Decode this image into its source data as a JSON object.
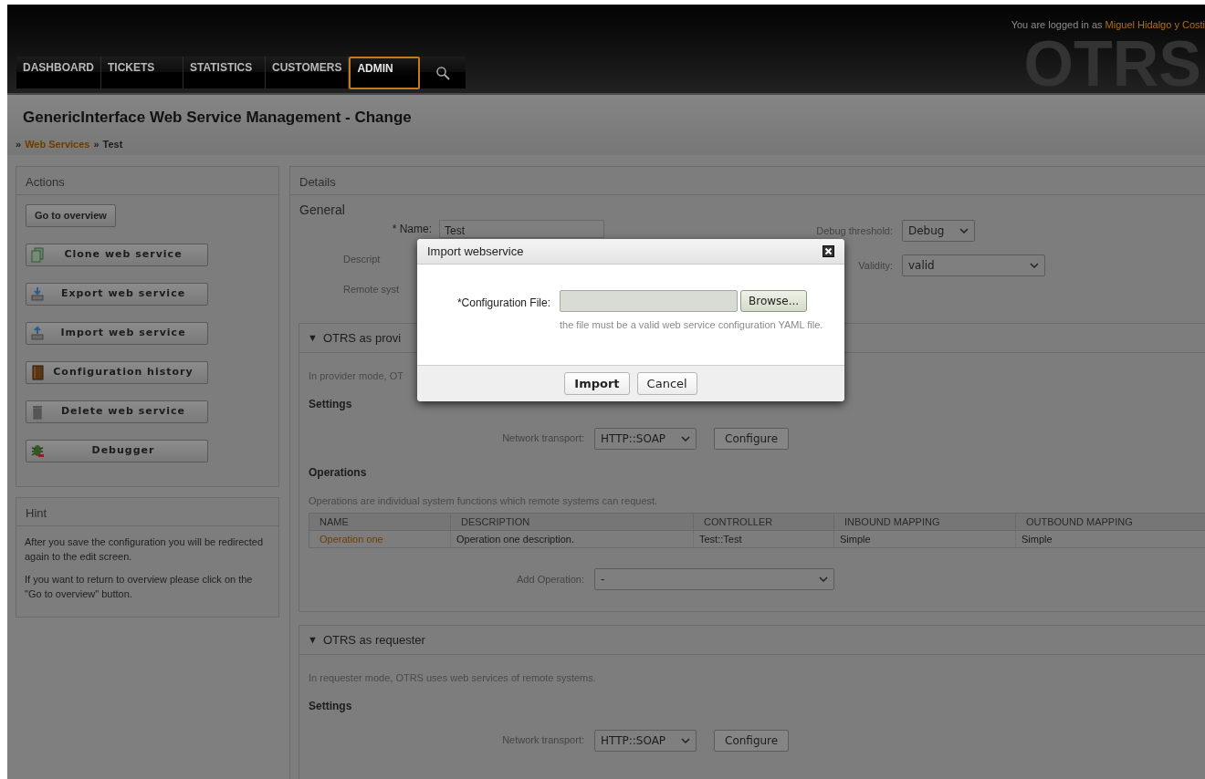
{
  "header": {
    "logo": "OTRS",
    "login_text": "You are logged in as",
    "user": "Miguel Hidalgo y Costi"
  },
  "nav": [
    {
      "label": "DASHBOARD",
      "selected": false
    },
    {
      "label": "TICKETS",
      "selected": false
    },
    {
      "label": "STATISTICS",
      "selected": false
    },
    {
      "label": "CUSTOMERS",
      "selected": false
    },
    {
      "label": "ADMIN",
      "selected": true
    }
  ],
  "page_title": "GenericInterface Web Service Management - Change",
  "breadcrumb": [
    {
      "separator": "»",
      "label": "Web Services",
      "kind": "link"
    },
    {
      "separator": "»",
      "label": "Test",
      "kind": "current"
    }
  ],
  "actions": {
    "title": "Actions",
    "overview_button": "Go to overview",
    "buttons": [
      {
        "label": "Clone web service",
        "kind": "clone"
      },
      {
        "label": "Export web service",
        "kind": "export"
      },
      {
        "label": "Import web service",
        "kind": "import"
      },
      {
        "label": "Configuration history",
        "kind": "history"
      },
      {
        "label": "Delete web service",
        "kind": "delete"
      },
      {
        "label": "Debugger",
        "kind": "debugger"
      }
    ]
  },
  "hint": {
    "title": "Hint",
    "paragraphs": [
      "After you save the configuration you will be redirected again to the edit screen.",
      "If you want to return to overview please click on the \"Go to overview\" button."
    ]
  },
  "details": {
    "title": "Details",
    "general_title": "General",
    "left_fields": [
      {
        "label": "* Name:",
        "value": "Test"
      },
      {
        "label": "Descript"
      },
      {
        "label": "Remote syst"
      }
    ],
    "right_fields": [
      {
        "label": "Debug threshold:",
        "value": "Debug",
        "kind": "short"
      },
      {
        "label": "Validity:",
        "value": "valid",
        "kind": "long"
      }
    ]
  },
  "provider": {
    "toggle": "▼",
    "title": "OTRS as provi",
    "intro": "In provider mode, OT",
    "settings_title": "Settings",
    "transport_label": "Network transport:",
    "transport": "HTTP::SOAP",
    "configure": "Configure",
    "operations_title": "Operations",
    "operations_intro": "Operations are individual system functions which remote systems can request.",
    "table": {
      "columns": [
        "NAME",
        "DESCRIPTION",
        "CONTROLLER",
        "INBOUND MAPPING",
        "OUTBOUND MAPPING"
      ],
      "rows": [
        [
          "Operation one",
          "Operation one description.",
          "Test::Test",
          "Simple",
          "Simple"
        ]
      ]
    },
    "add_label": "Add Operation:",
    "add_value": "-"
  },
  "requester": {
    "toggle": "▼",
    "title": "OTRS as requester",
    "intro": "In requester mode, OTRS uses web services of remote systems.",
    "settings_title": "Settings",
    "transport_label": "Network transport:",
    "transport": "HTTP::SOAP",
    "configure": "Configure"
  },
  "dialog": {
    "title": "Import webservice",
    "field_label": "*Configuration File:",
    "browse": "Browse...",
    "hint": "the file must be a valid web service configuration YAML file.",
    "buttons": [
      {
        "label": "Import",
        "kind": "primary"
      },
      {
        "label": "Cancel",
        "kind": "secondary"
      }
    ]
  }
}
